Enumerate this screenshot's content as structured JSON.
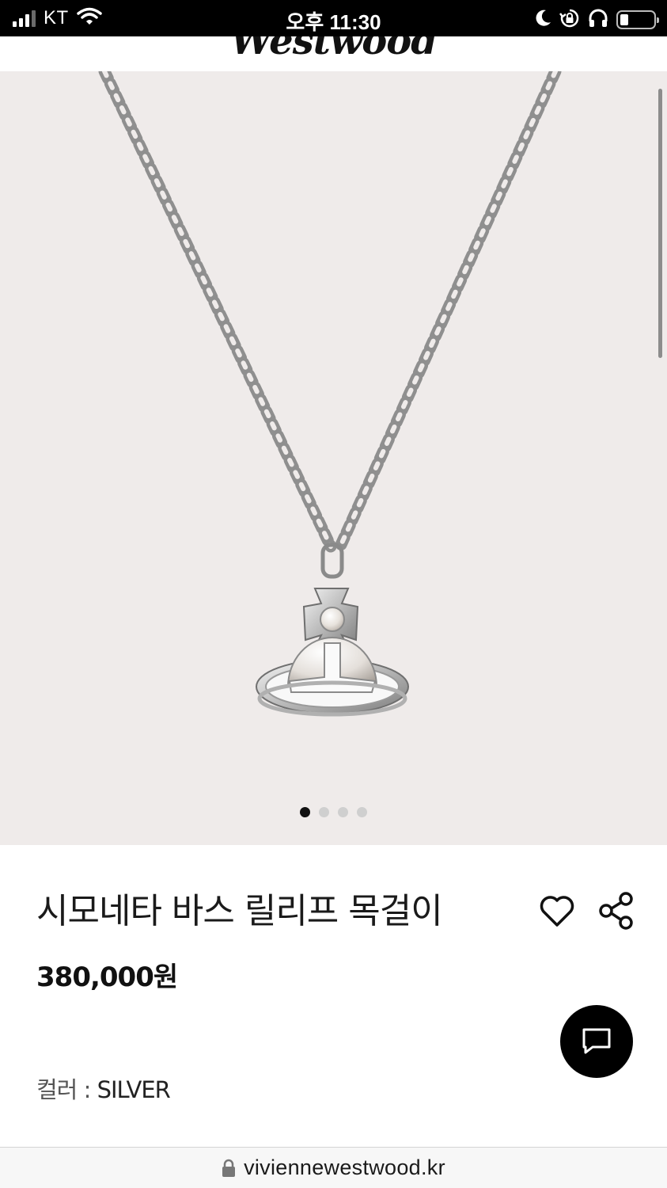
{
  "status_bar": {
    "carrier": "KT",
    "time": "오후 11:30",
    "signal_bars_filled": 3,
    "signal_bars_total": 4
  },
  "site": {
    "logo_text": "Westwood"
  },
  "gallery": {
    "image_count": 4,
    "active_index": 0,
    "background_color": "#efebea"
  },
  "product": {
    "title": "시모네타 바스 릴리프 목걸이",
    "price": "380,000원",
    "color_label": "컬러 :",
    "color_value": "SILVER"
  },
  "icons": {
    "wishlist": "heart-icon",
    "share": "share-icon",
    "chat": "chat-icon",
    "lock": "lock-icon"
  },
  "browser": {
    "url": "viviennewestwood.kr"
  },
  "colors": {
    "status_bar_bg": "#000000",
    "chat_button_bg": "#000000",
    "active_dot": "#111111",
    "inactive_dot": "#cfcfcf"
  }
}
